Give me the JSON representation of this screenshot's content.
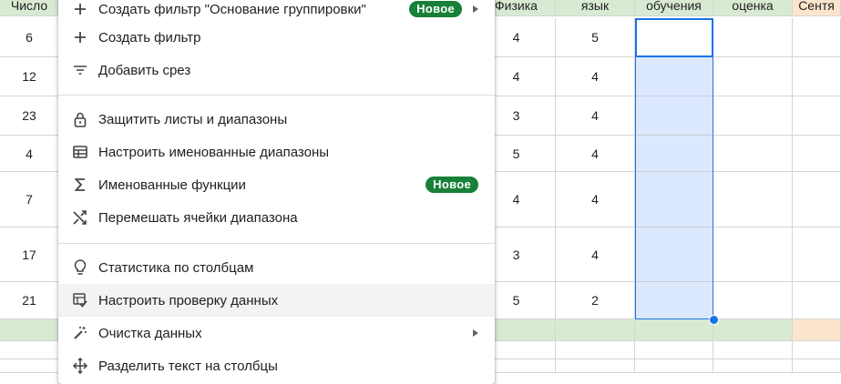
{
  "sheet": {
    "columns": [
      {
        "header": "Число"
      },
      {
        "header": ""
      },
      {
        "header": "Физика"
      },
      {
        "header": "язык"
      },
      {
        "header": "обучения"
      },
      {
        "header": "оценка"
      },
      {
        "header": "Сентя"
      }
    ],
    "rows": [
      [
        "6",
        "",
        "4",
        "5",
        "",
        "",
        ""
      ],
      [
        "12",
        "",
        "4",
        "4",
        "",
        "",
        ""
      ],
      [
        "23",
        "",
        "3",
        "4",
        "",
        "",
        ""
      ],
      [
        "4",
        "",
        "5",
        "4",
        "",
        "",
        ""
      ],
      [
        "7",
        "",
        "4",
        "4",
        "",
        "",
        ""
      ],
      [
        "17",
        "",
        "3",
        "4",
        "",
        "",
        ""
      ],
      [
        "21",
        "",
        "5",
        "2",
        "",
        "",
        ""
      ]
    ],
    "colors": {
      "header_green": "#d9ead3",
      "header_orange": "#fce5cd",
      "selection": "#1a73e8",
      "badge": "#188038"
    }
  },
  "menu": {
    "items": [
      {
        "label": "Создать фильтр \"Основание группировки\"",
        "icon": "plus-icon",
        "badge": "Новое",
        "submenu": true
      },
      {
        "label": "Создать фильтр",
        "icon": "plus-icon"
      },
      {
        "label": "Добавить срез",
        "icon": "filter-lines-icon"
      },
      {
        "label": "Защитить листы и диапазоны",
        "icon": "lock-icon"
      },
      {
        "label": "Настроить именованные диапазоны",
        "icon": "table-icon"
      },
      {
        "label": "Именованные функции",
        "icon": "sigma-icon",
        "badge": "Новое"
      },
      {
        "label": "Перемешать ячейки диапазона",
        "icon": "shuffle-icon"
      },
      {
        "label": "Статистика по столбцам",
        "icon": "lightbulb-icon"
      },
      {
        "label": "Настроить проверку данных",
        "icon": "data-validation-icon"
      },
      {
        "label": "Очистка данных",
        "icon": "magic-wand-icon",
        "submenu": true
      },
      {
        "label": "Разделить текст на столбцы",
        "icon": "split-columns-icon"
      }
    ]
  }
}
